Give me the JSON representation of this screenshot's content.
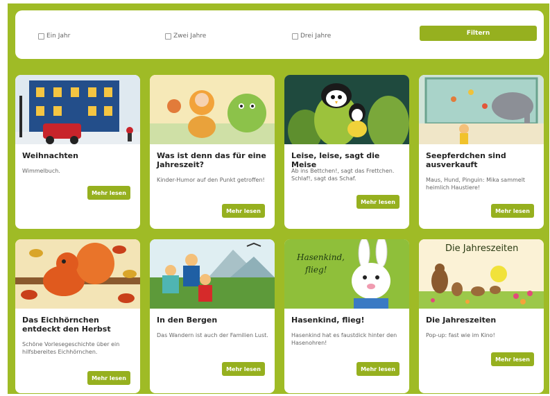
{
  "filter": {
    "options": [
      "Ein Jahr",
      "Zwei Jahre",
      "Drei Jahre"
    ],
    "button": "Filtern"
  },
  "books": [
    {
      "title": "Weihnachten",
      "desc": "Wimmelbuch.",
      "more": "Mehr lesen",
      "cover_text": ""
    },
    {
      "title": "Was ist denn das für eine Jahreszeit?",
      "desc": "Kinder-Humor auf den Punkt getroffen!",
      "more": "Mehr lesen",
      "cover_text": ""
    },
    {
      "title": "Leise, leise, sagt die Meise",
      "desc": "Ab ins Bettchen!, sagt das Frettchen. Schlaf!, sagt das Schaf.",
      "more": "Mehr lesen",
      "cover_text": ""
    },
    {
      "title": "Seepferdchen sind ausverkauft",
      "desc": "Maus, Hund, Pinguin: Mika sammelt heimlich Haustiere!",
      "more": "Mehr lesen",
      "cover_text": ""
    },
    {
      "title": "Das Eichhörnchen entdeckt den Herbst",
      "desc": "Schöne Vorlesegeschichte über ein hilfsbereites Eichhörnchen.",
      "more": "Mehr lesen",
      "cover_text": ""
    },
    {
      "title": "In den Bergen",
      "desc": "Das Wandern ist auch der Familien Lust.",
      "more": "Mehr lesen",
      "cover_text": ""
    },
    {
      "title": "Hasenkind, flieg!",
      "desc": "Hasenkind hat es faustdick hinter den Hasenohren!",
      "more": "Mehr lesen",
      "cover_text": "Hasenkind, flieg!"
    },
    {
      "title": "Die Jahreszeiten",
      "desc": "Pop-up: fast wie im Kino!",
      "more": "Mehr lesen",
      "cover_text": "Die Jahreszeiten"
    }
  ],
  "colors": {
    "frame": "#9fbb26",
    "button": "#96b01f"
  }
}
